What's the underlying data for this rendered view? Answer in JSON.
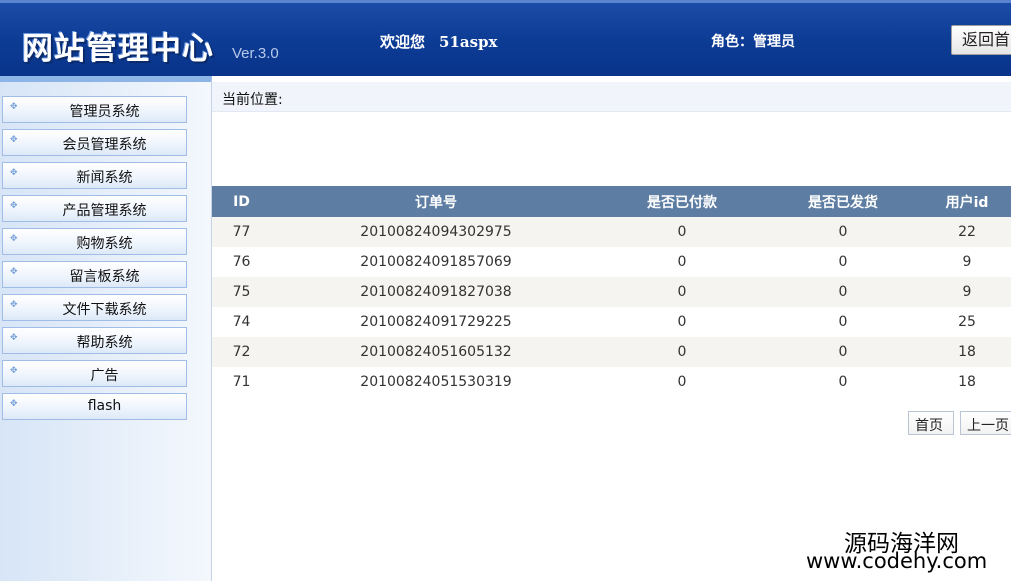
{
  "header": {
    "title": "网站管理中心",
    "version": "Ver.3.0",
    "welcome_label": "欢迎您",
    "username": "51aspx",
    "role": "角色：管理员",
    "home_button": "返回首页"
  },
  "sidebar": {
    "items": [
      {
        "label": "管理员系统"
      },
      {
        "label": "会员管理系统"
      },
      {
        "label": "新闻系统"
      },
      {
        "label": "产品管理系统"
      },
      {
        "label": "购物系统"
      },
      {
        "label": "留言板系统"
      },
      {
        "label": "文件下载系统"
      },
      {
        "label": "帮助系统"
      },
      {
        "label": "广告"
      },
      {
        "label": "flash"
      }
    ]
  },
  "breadcrumb": {
    "label": "当前位置:"
  },
  "table": {
    "headers": [
      "ID",
      "订单号",
      "是否已付款",
      "是否已发货",
      "用户id"
    ],
    "rows": [
      [
        "77",
        "20100824094302975",
        "0",
        "0",
        "22"
      ],
      [
        "76",
        "20100824091857069",
        "0",
        "0",
        "9"
      ],
      [
        "75",
        "20100824091827038",
        "0",
        "0",
        "9"
      ],
      [
        "74",
        "20100824091729225",
        "0",
        "0",
        "25"
      ],
      [
        "72",
        "20100824051605132",
        "0",
        "0",
        "18"
      ],
      [
        "71",
        "20100824051530319",
        "0",
        "0",
        "18"
      ]
    ]
  },
  "pager": {
    "first": "首页",
    "prev": "上一页"
  },
  "watermark": {
    "line1": "源码海洋网",
    "line2": "www.codehy.com"
  }
}
